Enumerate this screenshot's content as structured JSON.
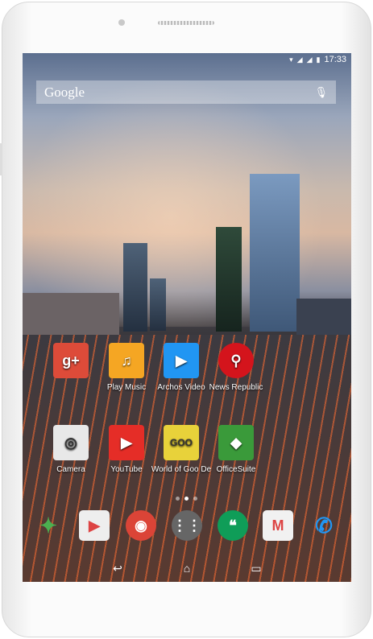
{
  "status_bar": {
    "time": "17:33",
    "icons": [
      "wifi-icon",
      "signal-icon",
      "signal-icon",
      "battery-icon"
    ]
  },
  "search": {
    "logo": "Google",
    "icon": "mic-icon"
  },
  "apps": [
    {
      "label": "",
      "icon": "google-plus-folder-icon",
      "color": "#dd4b39",
      "glyph": "g+"
    },
    {
      "label": "Play Music",
      "icon": "headphones-icon",
      "color": "#f5a623",
      "glyph": "♫"
    },
    {
      "label": "Archos Video",
      "icon": "play-icon",
      "color": "#2196f3",
      "glyph": "▶"
    },
    {
      "label": "News Republic",
      "icon": "news-republic-icon",
      "color": "#d4141c",
      "glyph": "⚲"
    },
    {
      "label": "Camera",
      "icon": "camera-icon",
      "color": "#e8e8e8",
      "glyph": "◎"
    },
    {
      "label": "YouTube",
      "icon": "youtube-icon",
      "color": "#e52d27",
      "glyph": "▶"
    },
    {
      "label": "World of Goo De",
      "icon": "world-of-goo-icon",
      "color": "#e8d23a",
      "glyph": "GOO"
    },
    {
      "label": "OfficeSuite",
      "icon": "officesuite-icon",
      "color": "#3a9a3a",
      "glyph": "◆"
    }
  ],
  "dock": [
    {
      "icon": "photos-icon",
      "color": "#4caf50",
      "glyph": "✦"
    },
    {
      "icon": "play-store-icon",
      "color": "#eeeeee",
      "glyph": "▶"
    },
    {
      "icon": "chrome-icon",
      "color": "#db4437",
      "glyph": "◉"
    },
    {
      "icon": "app-drawer-icon",
      "color": "#666666",
      "glyph": "⋮⋮"
    },
    {
      "icon": "hangouts-icon",
      "color": "#0f9d58",
      "glyph": "❝"
    },
    {
      "icon": "gmail-icon",
      "color": "#f1f1f1",
      "glyph": "M"
    },
    {
      "icon": "phone-icon",
      "color": "#2196f3",
      "glyph": "✆"
    }
  ],
  "nav": {
    "back": "↩",
    "home": "⌂",
    "recents": "▭"
  }
}
